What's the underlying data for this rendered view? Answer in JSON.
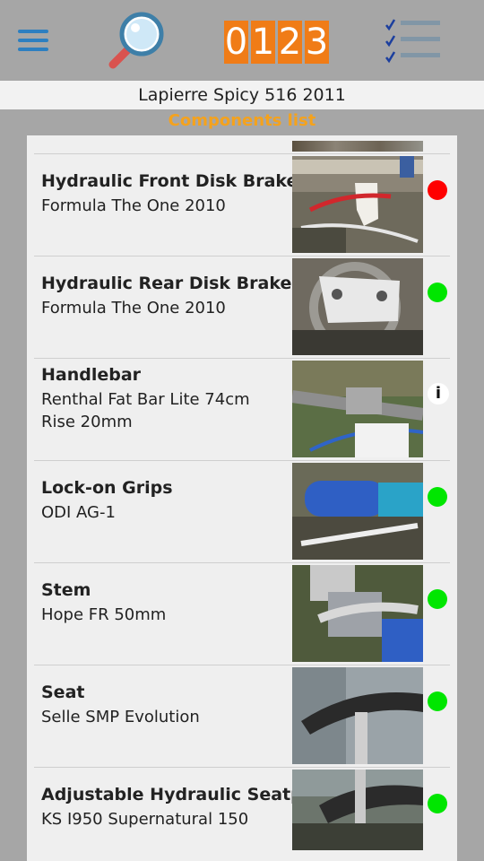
{
  "header": {
    "counter": [
      "0",
      "1",
      "2",
      "3"
    ],
    "menu_icon": "hamburger-icon",
    "search_icon": "magnifier-icon",
    "list_icon": "checklist-icon"
  },
  "bike_title": "Lapierre Spicy 516 2011",
  "section_title": "Components list",
  "colors": {
    "accent": "#f07c17",
    "status_ok": "#00e600",
    "status_bad": "#ff0000",
    "menu_blue": "#2d7fc0"
  },
  "components": [
    {
      "name": "Hydraulic Front Disk Brake",
      "desc": "Formula The One 2010",
      "status": "bad"
    },
    {
      "name": "Hydraulic Rear Disk Brake",
      "desc": "Formula The One 2010",
      "status": "ok"
    },
    {
      "name": "Handlebar",
      "desc": "Renthal Fat Bar Lite 74cm Rise 20mm",
      "status": "info",
      "info_label": "i"
    },
    {
      "name": "Lock-on Grips",
      "desc": "ODI AG-1",
      "status": "ok"
    },
    {
      "name": "Stem",
      "desc": "Hope FR 50mm",
      "status": "ok"
    },
    {
      "name": "Seat",
      "desc": "Selle SMP Evolution",
      "status": "ok"
    },
    {
      "name": "Adjustable Hydraulic Seatpost",
      "desc": "KS I950 Supernatural 150",
      "status": "ok"
    }
  ]
}
